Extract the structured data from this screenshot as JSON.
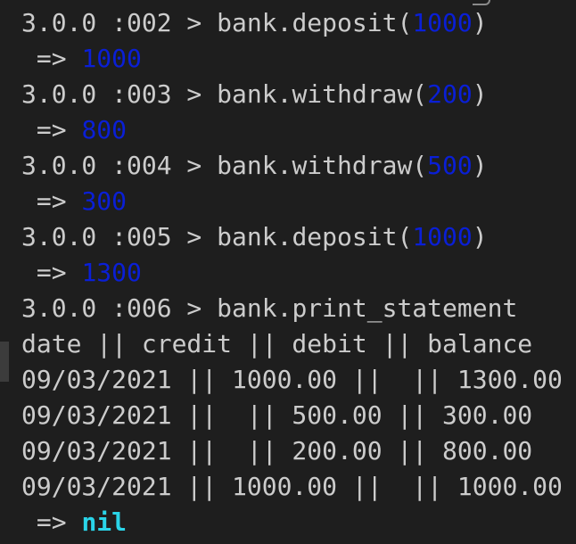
{
  "terminal": {
    "lines": [
      {
        "kind": "input",
        "prompt": "3.0.0 :002 > ",
        "code_before": "bank.deposit(",
        "arg": "1000",
        "code_after": ")"
      },
      {
        "kind": "result",
        "arrow": " => ",
        "value": "1000"
      },
      {
        "kind": "input",
        "prompt": "3.0.0 :003 > ",
        "code_before": "bank.withdraw(",
        "arg": "200",
        "code_after": ")"
      },
      {
        "kind": "result",
        "arrow": " => ",
        "value": "800"
      },
      {
        "kind": "input",
        "prompt": "3.0.0 :004 > ",
        "code_before": "bank.withdraw(",
        "arg": "500",
        "code_after": ")"
      },
      {
        "kind": "result",
        "arrow": " => ",
        "value": "300"
      },
      {
        "kind": "input",
        "prompt": "3.0.0 :005 > ",
        "code_before": "bank.deposit(",
        "arg": "1000",
        "code_after": ")"
      },
      {
        "kind": "result",
        "arrow": " => ",
        "value": "1300"
      },
      {
        "kind": "input",
        "prompt": "3.0.0 :006 > ",
        "code_before": "bank.print_statement",
        "arg": "",
        "code_after": ""
      },
      {
        "kind": "text",
        "text": "date || credit || debit || balance"
      },
      {
        "kind": "text",
        "text": "09/03/2021 || 1000.00 ||  || 1300.00"
      },
      {
        "kind": "text",
        "text": "09/03/2021 ||  || 500.00 || 300.00"
      },
      {
        "kind": "text",
        "text": "09/03/2021 ||  || 200.00 || 800.00"
      },
      {
        "kind": "text",
        "text": "09/03/2021 || 1000.00 ||  || 1000.00"
      },
      {
        "kind": "result",
        "arrow": " => ",
        "value": "nil",
        "style": "nil"
      }
    ]
  },
  "colors": {
    "background": "#1e1e1e",
    "text": "#cccccc",
    "number": "#0a1fd6",
    "nil": "#2ad4e8"
  }
}
